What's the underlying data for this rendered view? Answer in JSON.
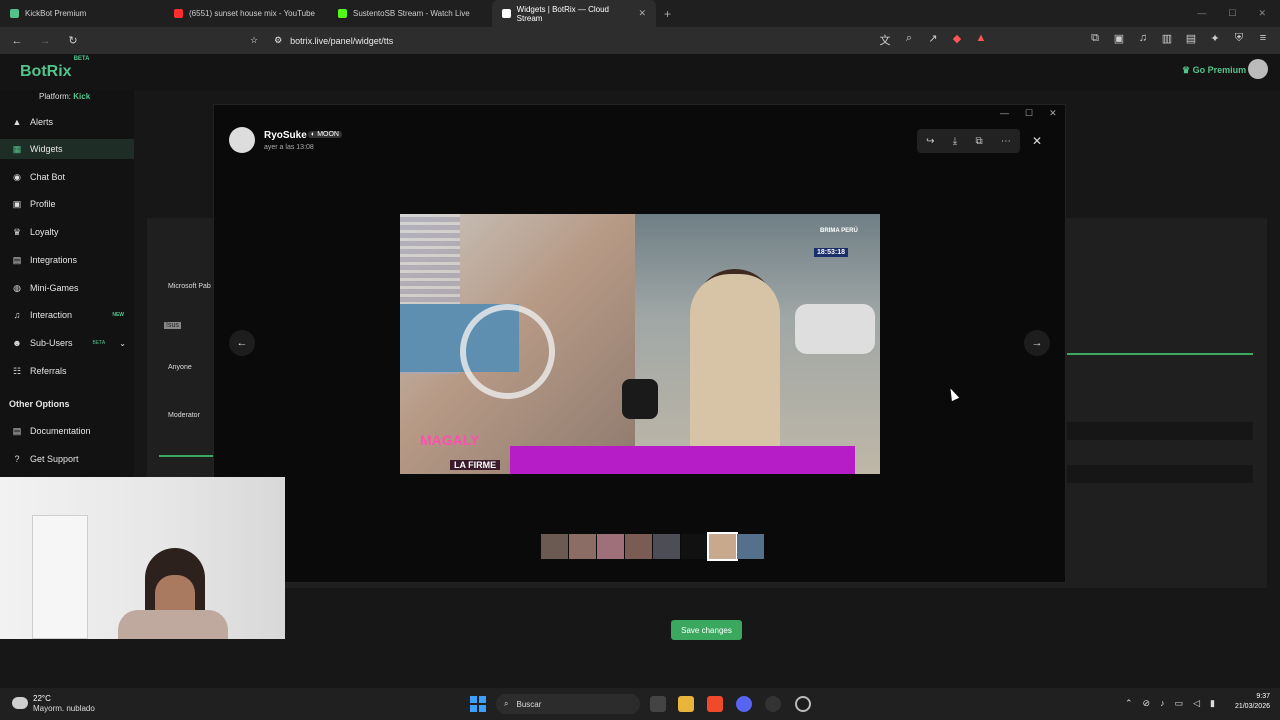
{
  "browser": {
    "tabs": [
      {
        "title": "KickBot Premium",
        "color": "#53c28b"
      },
      {
        "title": "(6551) sunset house mix - YouTube",
        "color": "#ff2d2d"
      },
      {
        "title": "SustentoSB Stream - Watch Live",
        "color": "#53fc18"
      },
      {
        "title": "Widgets | BotRix — Cloud Stream",
        "color": "#ffffff"
      }
    ],
    "url": "botrix.live/panel/widget/tts"
  },
  "app": {
    "logo": "BotRix",
    "logo_badge": "BETA",
    "premium": "Go Premium",
    "platform_label": "Platform:",
    "platform_value": "Kick"
  },
  "sidebar": {
    "items": [
      {
        "label": "Alerts",
        "icon": "bell-icon"
      },
      {
        "label": "Widgets",
        "icon": "grid-icon"
      },
      {
        "label": "Chat Bot",
        "icon": "robot-icon"
      },
      {
        "label": "Profile",
        "icon": "profile-icon"
      },
      {
        "label": "Loyalty",
        "icon": "trophy-icon"
      },
      {
        "label": "Integrations",
        "icon": "integrations-icon"
      },
      {
        "label": "Mini-Games",
        "icon": "gamepad-icon"
      },
      {
        "label": "Interaction",
        "icon": "music-icon",
        "badge": "NEW"
      },
      {
        "label": "Sub-Users",
        "icon": "users-icon",
        "badge": "BETA"
      },
      {
        "label": "Referrals",
        "icon": "referrals-icon"
      }
    ],
    "other_title": "Other Options",
    "other_items": [
      {
        "label": "Documentation",
        "icon": "doc-icon"
      },
      {
        "label": "Get Support",
        "icon": "help-icon"
      }
    ]
  },
  "background_form": {
    "fields": [
      "Microsoft Pab",
      "!sus",
      "Anyone",
      "Moderator"
    ]
  },
  "viewer": {
    "username": "RyoSuke",
    "role_tag": "MOON",
    "timestamp": "ayer a las 13:08",
    "media_overlay": {
      "peru_label": "BRIMA PERÚ",
      "clock": "18:53:18",
      "show_logo": "MAGALY",
      "show_sub": "LA FIRME"
    }
  },
  "save_button": "Save changes",
  "taskbar": {
    "temperature": "22°C",
    "weather": "Mayorm. nublado",
    "search": "Buscar",
    "time": "9:37",
    "date": "21/03/2026"
  }
}
